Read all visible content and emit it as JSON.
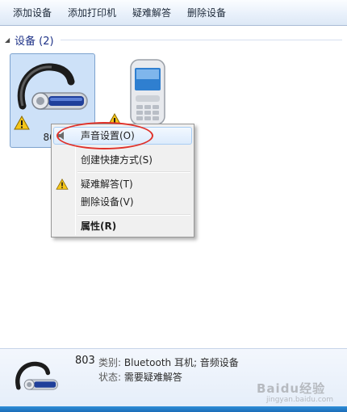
{
  "toolbar": {
    "items": [
      "添加设备",
      "添加打印机",
      "疑难解答",
      "删除设备"
    ]
  },
  "group": {
    "title": "设备 (2)"
  },
  "devices": [
    {
      "label": "803",
      "icon": "bluetooth-headset-icon",
      "warning": true,
      "selected": true
    },
    {
      "label": "",
      "icon": "mobile-phone-icon",
      "warning": true,
      "selected": false
    }
  ],
  "context_menu": {
    "items": [
      {
        "label": "声音设置(O)",
        "highlighted": true
      },
      {
        "label": "创建快捷方式(S)"
      },
      {
        "label": "疑难解答(T)",
        "icon": "warning-icon"
      },
      {
        "label": "删除设备(V)"
      },
      {
        "label": "属性(R)",
        "bold": true
      }
    ]
  },
  "details": {
    "name": "803",
    "category_label": "类别:",
    "category_value": "Bluetooth 耳机; 音频设备",
    "status_label": "状态:",
    "status_value": "需要疑难解答"
  },
  "watermark": {
    "text": "Baidu经验",
    "sub": "jingyan.baidu.com"
  },
  "colors": {
    "accent": "#1e3287",
    "selection": "#cde1f8",
    "annotation_ring": "#e0322a"
  }
}
